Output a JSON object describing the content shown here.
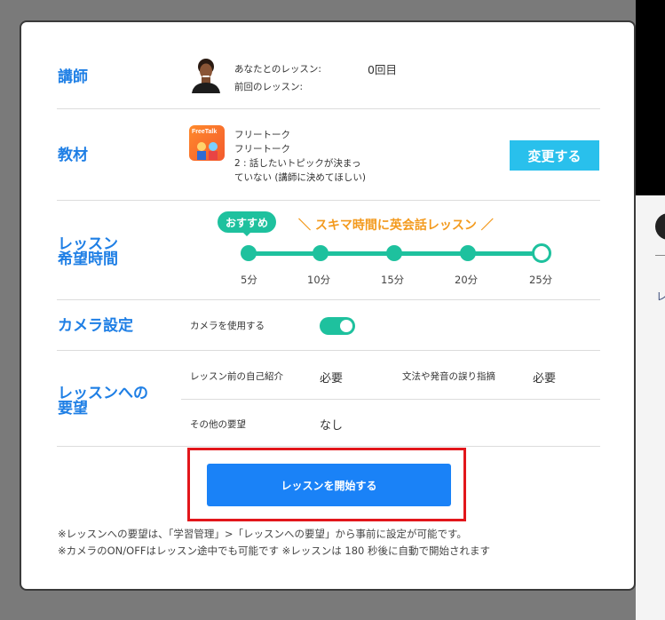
{
  "backdrop": {
    "side_label": "レ"
  },
  "teacher": {
    "title": "講師",
    "lessons_with_you_label": "あなたとのレッスン:",
    "lessons_with_you_value": "0回目",
    "previous_lesson_label": "前回のレッスン:"
  },
  "material": {
    "title": "教材",
    "icon_label": "FreeTalk",
    "line1": "フリートーク",
    "line2": "フリートーク",
    "line3": "2 : 話したいトピックが決まっ",
    "line4": "ていない (講師に決めてほしい)",
    "change_button": "変更する"
  },
  "duration": {
    "title_line1": "レッスン",
    "title_line2": "希望時間",
    "badge": "おすすめ",
    "promo": "＼ スキマ時間に英会話レッスン ／",
    "options": [
      "5分",
      "10分",
      "15分",
      "20分",
      "25分"
    ],
    "selected": "25分"
  },
  "camera": {
    "title": "カメラ設定",
    "use_label": "カメラを使用する",
    "enabled": true
  },
  "requests": {
    "title_line1": "レッスンへの",
    "title_line2": "要望",
    "self_intro_label": "レッスン前の自己紹介",
    "self_intro_value": "必要",
    "correction_label": "文法や発音の誤り指摘",
    "correction_value": "必要",
    "other_label": "その他の要望",
    "other_value": "なし"
  },
  "start_button": "レッスンを開始する",
  "notes": {
    "line1": "※レッスンへの要望は、「学習管理」>「レッスンへの要望」から事前に設定が可能です。",
    "line2": "※カメラのON/OFFはレッスン途中でも可能です ※レッスンは 180 秒後に自動で開始されます"
  },
  "colors": {
    "accent_blue": "#1f7fe5",
    "green": "#1ec19e",
    "orange": "#f39a1e",
    "cyan_button": "#29c0ec",
    "start_button": "#1a82f7",
    "highlight_red": "#e2161b"
  }
}
